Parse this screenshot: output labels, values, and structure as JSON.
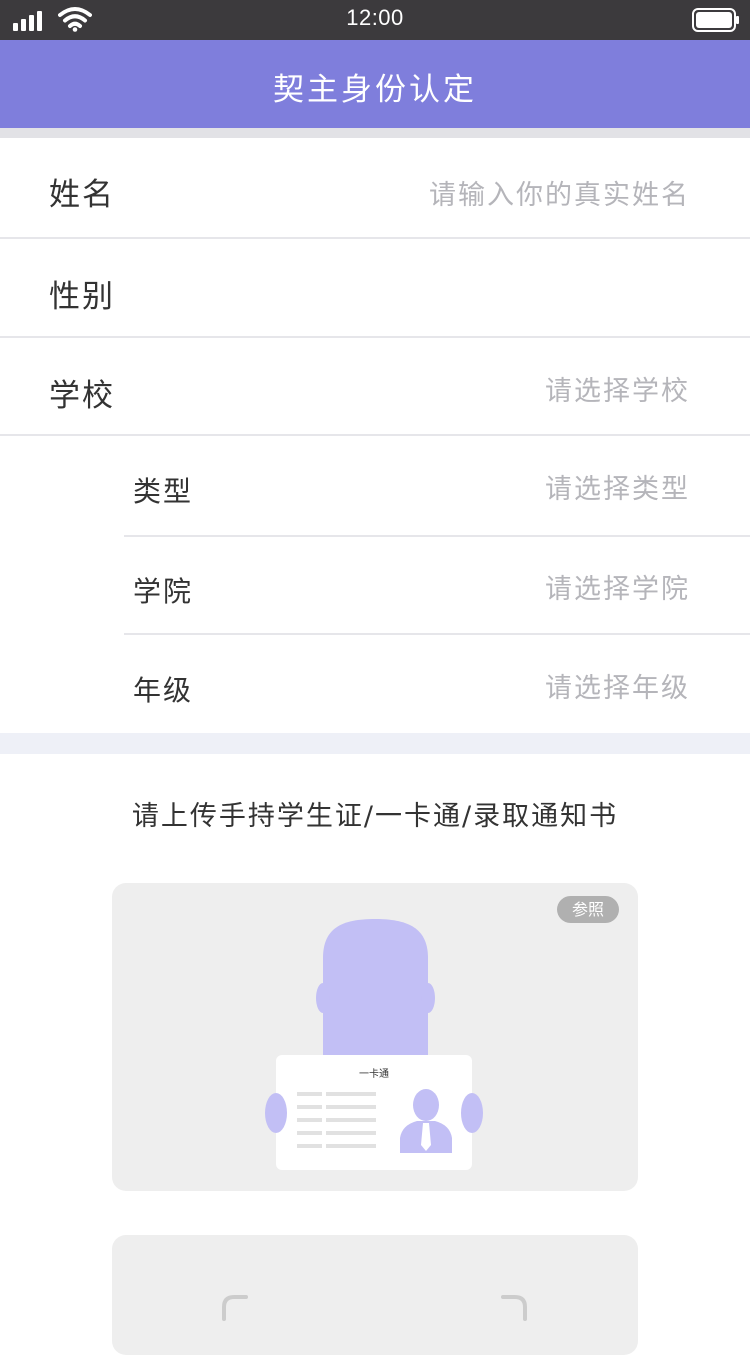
{
  "status_bar": {
    "time": "12:00",
    "signal_icon": "signal-bars-icon",
    "wifi_icon": "wifi-icon",
    "battery_icon": "battery-icon"
  },
  "nav": {
    "title": "契主身份认定"
  },
  "form": {
    "name": {
      "label": "姓名",
      "placeholder": "请输入你的真实姓名"
    },
    "gender": {
      "label": "性别",
      "value": ""
    },
    "school": {
      "label": "学校",
      "placeholder": "请选择学校"
    },
    "type": {
      "label": "类型",
      "placeholder": "请选择类型"
    },
    "college": {
      "label": "学院",
      "placeholder": "请选择学院"
    },
    "grade": {
      "label": "年级",
      "placeholder": "请选择年级"
    }
  },
  "upload": {
    "title": "请上传手持学生证/一卡通/录取通知书",
    "sample_badge": "参照",
    "sample_card_text": "一卡通"
  },
  "colors": {
    "accent": "#7f7edc",
    "illustration": "#c2bff5",
    "status_bar": "#3c3a3d",
    "placeholder": "#b5b5ba"
  }
}
